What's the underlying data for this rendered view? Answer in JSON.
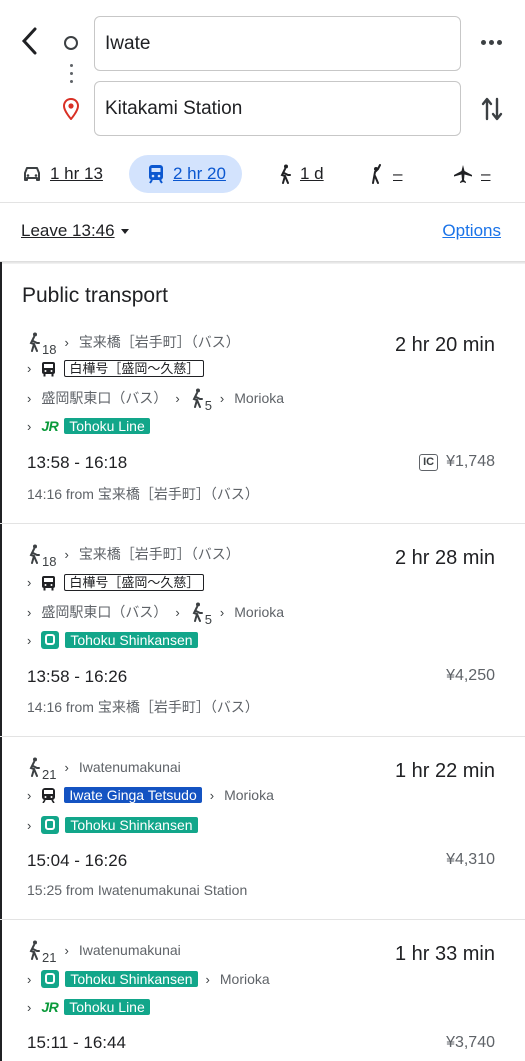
{
  "search": {
    "origin": "Iwate",
    "destination": "Kitakami Station"
  },
  "modes": [
    {
      "name": "driving",
      "label": "1 hr 13",
      "icon": "car-icon"
    },
    {
      "name": "transit",
      "label": "2 hr 20",
      "icon": "train-icon",
      "active": true
    },
    {
      "name": "walking",
      "label": "1 d",
      "icon": "walk-icon"
    },
    {
      "name": "ride-hailing",
      "label": "–",
      "icon": "hail-icon"
    },
    {
      "name": "flight",
      "label": "–",
      "icon": "plane-icon"
    }
  ],
  "leave": {
    "label": "Leave 13:46"
  },
  "options_label": "Options",
  "section_title": "Public transport",
  "routes": [
    {
      "walk1": "18",
      "stop1": "宝来橋［岩手町］（バス）",
      "duration": "2 hr 20 min",
      "bus_name": "白樺号［盛岡〜久慈］",
      "stop2": "盛岡駅東口（バス）",
      "walk2": "5",
      "stop3": "Morioka",
      "line": "Tohoku Line",
      "times": "13:58 - 16:18",
      "fare": "¥1,748",
      "ic": "IC",
      "note": "14:16 from 宝来橋［岩手町］（バス）"
    },
    {
      "walk1": "18",
      "stop1": "宝来橋［岩手町］（バス）",
      "duration": "2 hr 28 min",
      "bus_name": "白樺号［盛岡〜久慈］",
      "stop2": "盛岡駅東口（バス）",
      "walk2": "5",
      "stop3": "Morioka",
      "line": "Tohoku Shinkansen",
      "times": "13:58 - 16:26",
      "fare": "¥4,250",
      "note": "14:16 from 宝来橋［岩手町］（バス）"
    },
    {
      "walk1": "21",
      "stop1": "Iwatenumakunai",
      "duration": "1 hr 22 min",
      "line1": "Iwate Ginga Tetsudo",
      "stop2": "Morioka",
      "line2": "Tohoku Shinkansen",
      "times": "15:04 - 16:26",
      "fare": "¥4,310",
      "note": "15:25 from Iwatenumakunai Station"
    },
    {
      "walk1": "21",
      "stop1": "Iwatenumakunai",
      "duration": "1 hr 33 min",
      "line1": "Tohoku Shinkansen",
      "stop2": "Morioka",
      "line2": "Tohoku Line",
      "times": "15:11 - 16:44",
      "fare": "¥3,740"
    }
  ],
  "colors": {
    "accent": "#0b57d0",
    "shinkansen": "#12a68a",
    "ginga": "#1453c2",
    "jr": "#0a9a3a",
    "pin": "#d93025"
  }
}
